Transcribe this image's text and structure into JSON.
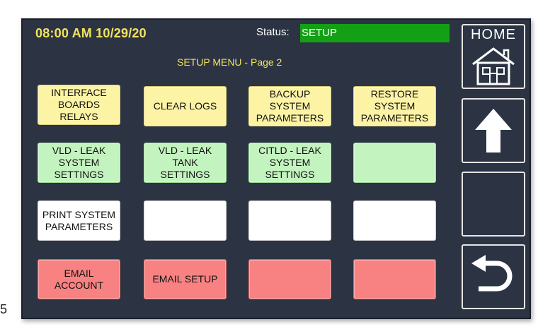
{
  "header": {
    "clock": "08:00 AM 10/29/20",
    "status_label": "Status:",
    "status_value": "SETUP"
  },
  "menu": {
    "title": "SETUP MENU - Page 2",
    "buttons": [
      {
        "label": "INTERFACE\nBOARDS\nRELAYS",
        "color": "#fdf3a4"
      },
      {
        "label": "CLEAR LOGS",
        "color": "#fdf3a4"
      },
      {
        "label": "BACKUP\nSYSTEM\nPARAMETERS",
        "color": "#fdf3a4"
      },
      {
        "label": "RESTORE\nSYSTEM\nPARAMETERS",
        "color": "#fdf3a4"
      },
      {
        "label": "VLD - LEAK\nSYSTEM\nSETTINGS",
        "color": "#c3f3bf"
      },
      {
        "label": "VLD -  LEAK\nTANK\nSETTINGS",
        "color": "#c3f3bf"
      },
      {
        "label": "CITLD - LEAK\nSYSTEM\nSETTINGS",
        "color": "#c3f3bf"
      },
      {
        "label": "",
        "color": "#c3f3bf"
      },
      {
        "label": "PRINT SYSTEM\nPARAMETERS",
        "color": "#ffffff"
      },
      {
        "label": "",
        "color": "#ffffff"
      },
      {
        "label": "",
        "color": "#ffffff"
      },
      {
        "label": "",
        "color": "#ffffff"
      },
      {
        "label": "EMAIL\nACCOUNT",
        "color": "#f88282"
      },
      {
        "label": "EMAIL SETUP",
        "color": "#f88282"
      },
      {
        "label": "",
        "color": "#f88282"
      },
      {
        "label": "",
        "color": "#f88282"
      }
    ]
  },
  "sidebar": {
    "home_label": "HOME",
    "home_icon": "house-icon",
    "up_icon": "arrow-up-icon",
    "back_icon": "return-arrow-icon"
  },
  "footer": {
    "page_number": "5"
  }
}
